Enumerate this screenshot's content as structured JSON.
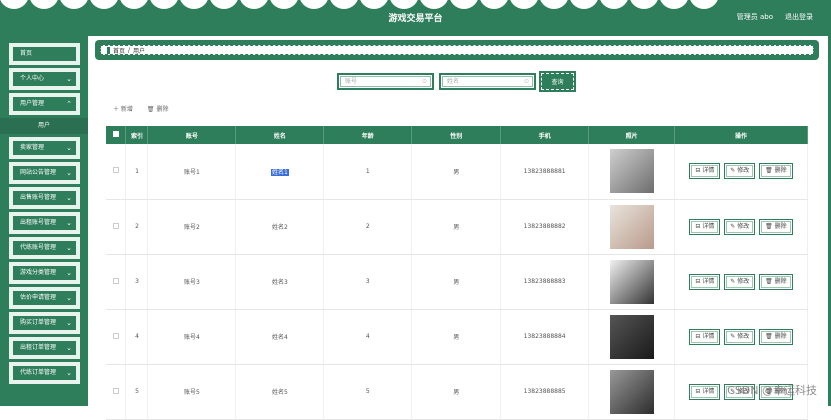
{
  "header": {
    "title": "游戏交易平台",
    "admin_label": "管理员 abo",
    "logout_label": "退出登录"
  },
  "sidebar": {
    "items": [
      {
        "label": "首页",
        "chevron": false
      },
      {
        "label": "个人中心",
        "chevron": true
      },
      {
        "label": "用户管理",
        "chevron": true
      },
      {
        "label": "卖家管理",
        "chevron": true
      },
      {
        "label": "网站公告管理",
        "chevron": true
      },
      {
        "label": "出售账号管理",
        "chevron": true
      },
      {
        "label": "出租账号管理",
        "chevron": true
      },
      {
        "label": "代练账号管理",
        "chevron": true
      },
      {
        "label": "游戏分类管理",
        "chevron": true
      },
      {
        "label": "估价申请管理",
        "chevron": true
      },
      {
        "label": "购买订单管理",
        "chevron": true
      },
      {
        "label": "出租订单管理",
        "chevron": true
      },
      {
        "label": "代练订单管理",
        "chevron": true
      }
    ],
    "active_sub": "用户"
  },
  "breadcrumb": {
    "home": "首页",
    "sep": "/",
    "current": "用户"
  },
  "search": {
    "account_placeholder": "账号",
    "name_placeholder": "姓名",
    "button_label": "查询"
  },
  "actions": {
    "add_label": "＋ 新增",
    "delete_label": "🗑 删除"
  },
  "table": {
    "headers": [
      "",
      "索引",
      "账号",
      "姓名",
      "年龄",
      "性别",
      "手机",
      "照片",
      "操作"
    ],
    "rows": [
      {
        "index": "1",
        "account": "账号1",
        "name": "姓名1",
        "age": "1",
        "gender": "男",
        "phone": "13823888881"
      },
      {
        "index": "2",
        "account": "账号2",
        "name": "姓名2",
        "age": "2",
        "gender": "男",
        "phone": "13823888882"
      },
      {
        "index": "3",
        "account": "账号3",
        "name": "姓名3",
        "age": "3",
        "gender": "男",
        "phone": "13823888883"
      },
      {
        "index": "4",
        "account": "账号4",
        "name": "姓名4",
        "age": "4",
        "gender": "男",
        "phone": "13823888884"
      },
      {
        "index": "5",
        "account": "账号5",
        "name": "姓名5",
        "age": "5",
        "gender": "男",
        "phone": "13823888885"
      }
    ],
    "ops": {
      "detail": "详情",
      "edit": "修改",
      "delete": "删除"
    }
  },
  "watermark": "CSDN @幸运科技",
  "colors": {
    "primary": "#2e7d5b",
    "selection": "#3a6fd8"
  }
}
